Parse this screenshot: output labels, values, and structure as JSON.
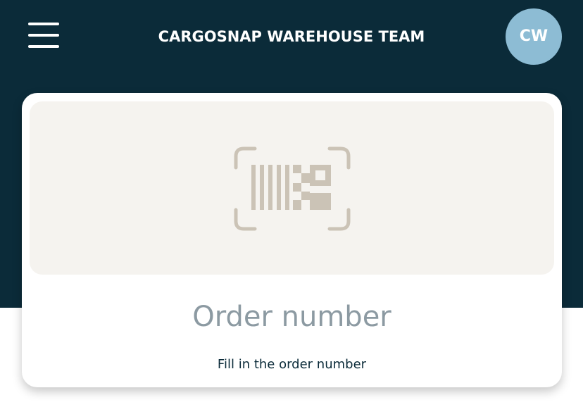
{
  "header": {
    "title": "CARGOSNAP WAREHOUSE TEAM",
    "avatar_initials": "CW",
    "background_color": "#0b2b39",
    "avatar_color": "#8dbcd4",
    "menu_icon": "hamburger-menu-icon"
  },
  "scanner": {
    "icon": "barcode-scan-icon",
    "icon_color": "#cbc3b6",
    "background_color": "#f5f3ef"
  },
  "order": {
    "label": "Order number",
    "input_placeholder": "Fill in the order number",
    "input_value": ""
  }
}
